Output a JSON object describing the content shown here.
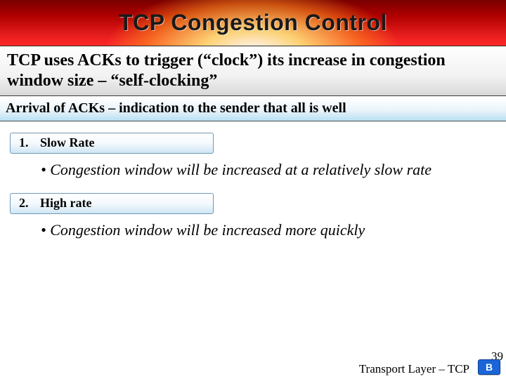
{
  "title": "TCP Congestion Control",
  "intro": "TCP uses ACKs to trigger (“clock”) its increase in congestion window size – “self-clocking”",
  "subhead": "Arrival of ACKs – indication to the sender that all is well",
  "items": [
    {
      "num": "1.",
      "label": "Slow Rate",
      "bullet": "• Congestion window will be increased at a relatively slow rate"
    },
    {
      "num": "2.",
      "label": "High rate",
      "bullet": "• Congestion window will be increased more quickly"
    }
  ],
  "footer": {
    "page": "39",
    "label": "Transport Layer – TCP",
    "back": "B"
  }
}
